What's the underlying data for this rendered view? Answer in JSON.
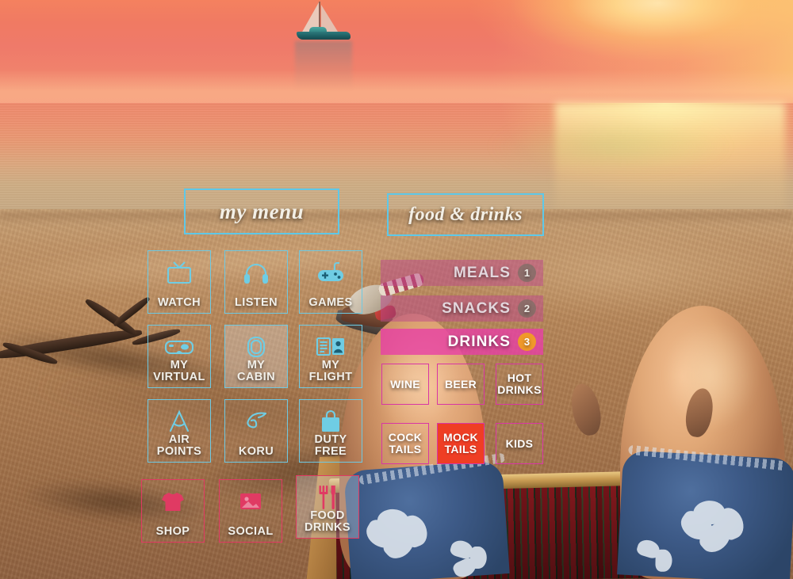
{
  "scene": {
    "description": "first-person beach sunset scene with sailboat, sand and deck chair",
    "sky_color": "#f07a63",
    "sun_color": "#fff6c8",
    "sand_color": "#b98a5d",
    "shorts_color": "#3d5a87"
  },
  "theme": {
    "cyan": "#6ec9e2",
    "pink": "#e03a63",
    "magenta": "#d836a4",
    "bar_pink": "#be488c",
    "bar_pink_active": "#e740a5",
    "badge_active": "#f0992a",
    "selected_red": "#ef3e24",
    "text": "#f2f0ea"
  },
  "my_menu": {
    "title": "my menu",
    "tiles": [
      {
        "id": "watch",
        "label_line1": "WATCH",
        "label_line2": "",
        "icon": "tv-icon",
        "accent": "cyan",
        "state": "default"
      },
      {
        "id": "listen",
        "label_line1": "LISTEN",
        "label_line2": "",
        "icon": "headphones-icon",
        "accent": "cyan",
        "state": "default"
      },
      {
        "id": "games",
        "label_line1": "GAMES",
        "label_line2": "",
        "icon": "gamepad-icon",
        "accent": "cyan",
        "state": "default"
      },
      {
        "id": "my-virtual",
        "label_line1": "MY",
        "label_line2": "VIRTUAL",
        "icon": "vr-goggles-icon",
        "accent": "cyan",
        "state": "default"
      },
      {
        "id": "my-cabin",
        "label_line1": "MY",
        "label_line2": "CABIN",
        "icon": "cabin-window-icon",
        "accent": "cyan",
        "state": "frosted"
      },
      {
        "id": "my-flight",
        "label_line1": "MY",
        "label_line2": "FLIGHT",
        "icon": "boarding-pass-icon",
        "accent": "cyan",
        "state": "default"
      },
      {
        "id": "air-points",
        "label_line1": "AIR",
        "label_line2": "POINTS",
        "icon": "airpoints-a-icon",
        "accent": "cyan",
        "state": "default"
      },
      {
        "id": "koru",
        "label_line1": "KORU",
        "label_line2": "",
        "icon": "koru-fern-icon",
        "accent": "cyan",
        "state": "default"
      },
      {
        "id": "duty-free",
        "label_line1": "DUTY",
        "label_line2": "FREE",
        "icon": "shopping-bag-icon",
        "accent": "cyan",
        "state": "default"
      },
      {
        "id": "shop",
        "label_line1": "SHOP",
        "label_line2": "",
        "icon": "tshirt-icon",
        "accent": "pink",
        "state": "default"
      },
      {
        "id": "social",
        "label_line1": "SOCIAL",
        "label_line2": "",
        "icon": "photo-icon",
        "accent": "pink",
        "state": "default"
      },
      {
        "id": "food-drinks",
        "label_line1": "FOOD",
        "label_line2": "DRINKS",
        "icon": "cutlery-icon",
        "accent": "pink",
        "state": "frosted"
      }
    ]
  },
  "food_drinks": {
    "title": "food & drinks",
    "categories": [
      {
        "id": "meals",
        "label": "MEALS",
        "badge": "1",
        "active": false
      },
      {
        "id": "snacks",
        "label": "SNACKS",
        "badge": "2",
        "active": false
      },
      {
        "id": "drinks",
        "label": "DRINKS",
        "badge": "3",
        "active": true
      }
    ],
    "drink_options": [
      {
        "id": "wine",
        "label_line1": "WINE",
        "label_line2": "",
        "selected": false
      },
      {
        "id": "beer",
        "label_line1": "BEER",
        "label_line2": "",
        "selected": false
      },
      {
        "id": "hot-drinks",
        "label_line1": "HOT",
        "label_line2": "DRINKS",
        "selected": false
      },
      {
        "id": "cocktails",
        "label_line1": "COCK",
        "label_line2": "TAILS",
        "selected": false
      },
      {
        "id": "mocktails",
        "label_line1": "MOCK",
        "label_line2": "TAILS",
        "selected": true
      },
      {
        "id": "kids",
        "label_line1": "KIDS",
        "label_line2": "",
        "selected": false
      }
    ]
  }
}
